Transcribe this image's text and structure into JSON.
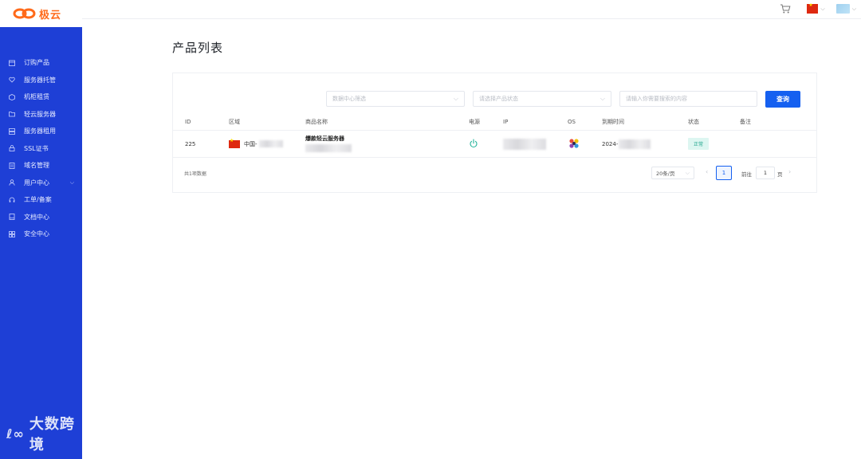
{
  "brand": {
    "name": "极云",
    "accent": "#ff6a1a"
  },
  "sidebar": {
    "color": "#1e3fd6",
    "items": [
      {
        "label": "订购产品",
        "icon": "calendar-icon"
      },
      {
        "label": "服务器托管",
        "icon": "heart-icon"
      },
      {
        "label": "机柜租赁",
        "icon": "cube-icon"
      },
      {
        "label": "轻云服务器",
        "icon": "folder-icon"
      },
      {
        "label": "服务器租用",
        "icon": "server-icon"
      },
      {
        "label": "SSL证书",
        "icon": "lock-icon"
      },
      {
        "label": "域名管理",
        "icon": "document-icon"
      },
      {
        "label": "用户中心",
        "icon": "user-icon",
        "expandable": true
      },
      {
        "label": "工单/备案",
        "icon": "headset-icon"
      },
      {
        "label": "文档中心",
        "icon": "book-icon"
      },
      {
        "label": "安全中心",
        "icon": "grid-icon"
      }
    ]
  },
  "topbar": {
    "cart_icon": "cart-icon",
    "language": "中文",
    "avatar_icon": "avatar-icon"
  },
  "page": {
    "title": "产品列表"
  },
  "filters": {
    "datacenter_placeholder": "数据中心筛选",
    "status_placeholder": "请选择产品状态",
    "search_placeholder": "请输入你需要搜索的内容",
    "query_label": "查询"
  },
  "table": {
    "headers": {
      "id": "ID",
      "region": "区域",
      "name": "商品名称",
      "power": "电源",
      "ip": "IP",
      "os": "OS",
      "expiry": "到期时间",
      "status": "状态",
      "note": "备注"
    },
    "rows": [
      {
        "id": "225",
        "region": "中国-",
        "name": "爆款轻云服务器",
        "power_icon": "power-icon",
        "os_icon": "os-logo-icon",
        "expiry": "2024-",
        "status": "正常",
        "status_color": "#22a68e"
      }
    ]
  },
  "pagination": {
    "total": "共1项数据",
    "page_size": "20条/页",
    "current_page": "1",
    "goto_label": "前往",
    "goto_value": "1",
    "goto_unit": "页"
  },
  "watermark": {
    "text": "大数跨境"
  }
}
